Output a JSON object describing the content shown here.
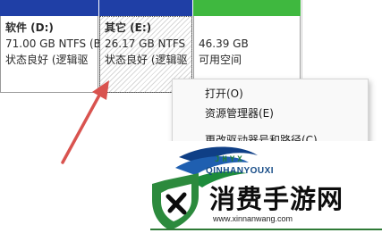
{
  "partitions": [
    {
      "name": "软件 (D:)",
      "size_fs": "71.00 GB NTFS (B",
      "status": "状态良好 (逻辑驱"
    },
    {
      "name": "其它 (E:)",
      "size_fs": "26.17 GB NTFS",
      "status": "状态良好 (逻辑驱"
    },
    {
      "name": "",
      "size_fs": "46.39 GB",
      "status": "可用空间"
    }
  ],
  "colors": {
    "logical_drive_bar": "#1f3fa6",
    "free_space_bar": "#3fb83f",
    "arrow": "#d9534f",
    "watermark_green": "#1c7d3a",
    "watermark_blue": "#144a86"
  },
  "context_menu": {
    "items": [
      {
        "label": "打开(O)"
      },
      {
        "label": "资源管理器(E)"
      },
      {
        "label": "更改驱动器号和路径(C)..."
      }
    ]
  },
  "watermark": {
    "brand_letters": "JHYX",
    "brand_sub": "QINHANYOUXI",
    "title": "消费手游网",
    "url": "www.xinnanwang.com"
  },
  "icons": {
    "arrow": "red-arrow-pointer",
    "logo": "swoosh-logo",
    "shield": "shield-x-icon"
  }
}
